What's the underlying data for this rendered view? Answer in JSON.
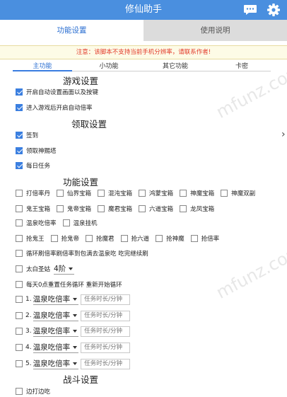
{
  "header": {
    "title": "修仙助手"
  },
  "main_tabs": [
    {
      "label": "功能设置"
    },
    {
      "label": "使用说明"
    }
  ],
  "notice": "注意：该脚本不支持当前手机分辨率，请联系作者!",
  "sub_tabs": [
    {
      "label": "主功能"
    },
    {
      "label": "小功能"
    },
    {
      "label": "其它功能"
    },
    {
      "label": "卡密"
    }
  ],
  "sections": {
    "game": "游戏设置",
    "collect": "领取设置",
    "function": "功能设置",
    "battle": "战斗设置"
  },
  "game_options": [
    {
      "label": "开启自动设置画面以及按键",
      "checked": true
    },
    {
      "label": "进入游戏后开启自动倍率",
      "checked": true
    }
  ],
  "collect_options": [
    {
      "label": "签到",
      "checked": true
    },
    {
      "label": "领取神赐塔",
      "checked": true
    },
    {
      "label": "每日任务",
      "checked": true
    }
  ],
  "function_rows": [
    [
      "打倍率丹",
      "仙界宝箱",
      "混沌宝箱",
      "鸿蒙宝箱",
      "神魔宝箱",
      "神魔双副"
    ],
    [
      "鬼王宝箱",
      "鬼帝宝箱",
      "魔君宝箱",
      "六道宝箱",
      "龙凤宝箱"
    ],
    [
      "温泉吃倍率",
      "温泉挂机"
    ],
    [
      "抢鬼王",
      "抢鬼帝",
      "抢魔君",
      "抢六道",
      "抢神魔",
      "抢倍率"
    ],
    [
      "循环刷倍率刷倍率到包满去温泉吃 吃完继续刷"
    ]
  ],
  "taibai": {
    "label": "太白圣姑",
    "value": "4阶"
  },
  "reset_task": {
    "label": "每天0点重置任务循环 重新开始循环"
  },
  "task_slots": [
    {
      "num": "1.",
      "select": "温泉吃倍率",
      "placeholder": "任务时长/分钟"
    },
    {
      "num": "2.",
      "select": "温泉吃倍率",
      "placeholder": "任务时长/分钟"
    },
    {
      "num": "3.",
      "select": "温泉吃倍率",
      "placeholder": "任务时长/分钟"
    },
    {
      "num": "4.",
      "select": "温泉吃倍率",
      "placeholder": "任务时长/分钟"
    },
    {
      "num": "5.",
      "select": "温泉吃倍率",
      "placeholder": "任务时长/分钟"
    }
  ],
  "battle_options": [
    {
      "label": "边打边吃",
      "checked": false
    }
  ],
  "watermark": "mfunz.com",
  "colors": {
    "header": "#4a8fdf",
    "checkbox_checked": "#3b7fe0",
    "notice_text": "#e23a2a",
    "tab_active": "#2a6ed1"
  }
}
